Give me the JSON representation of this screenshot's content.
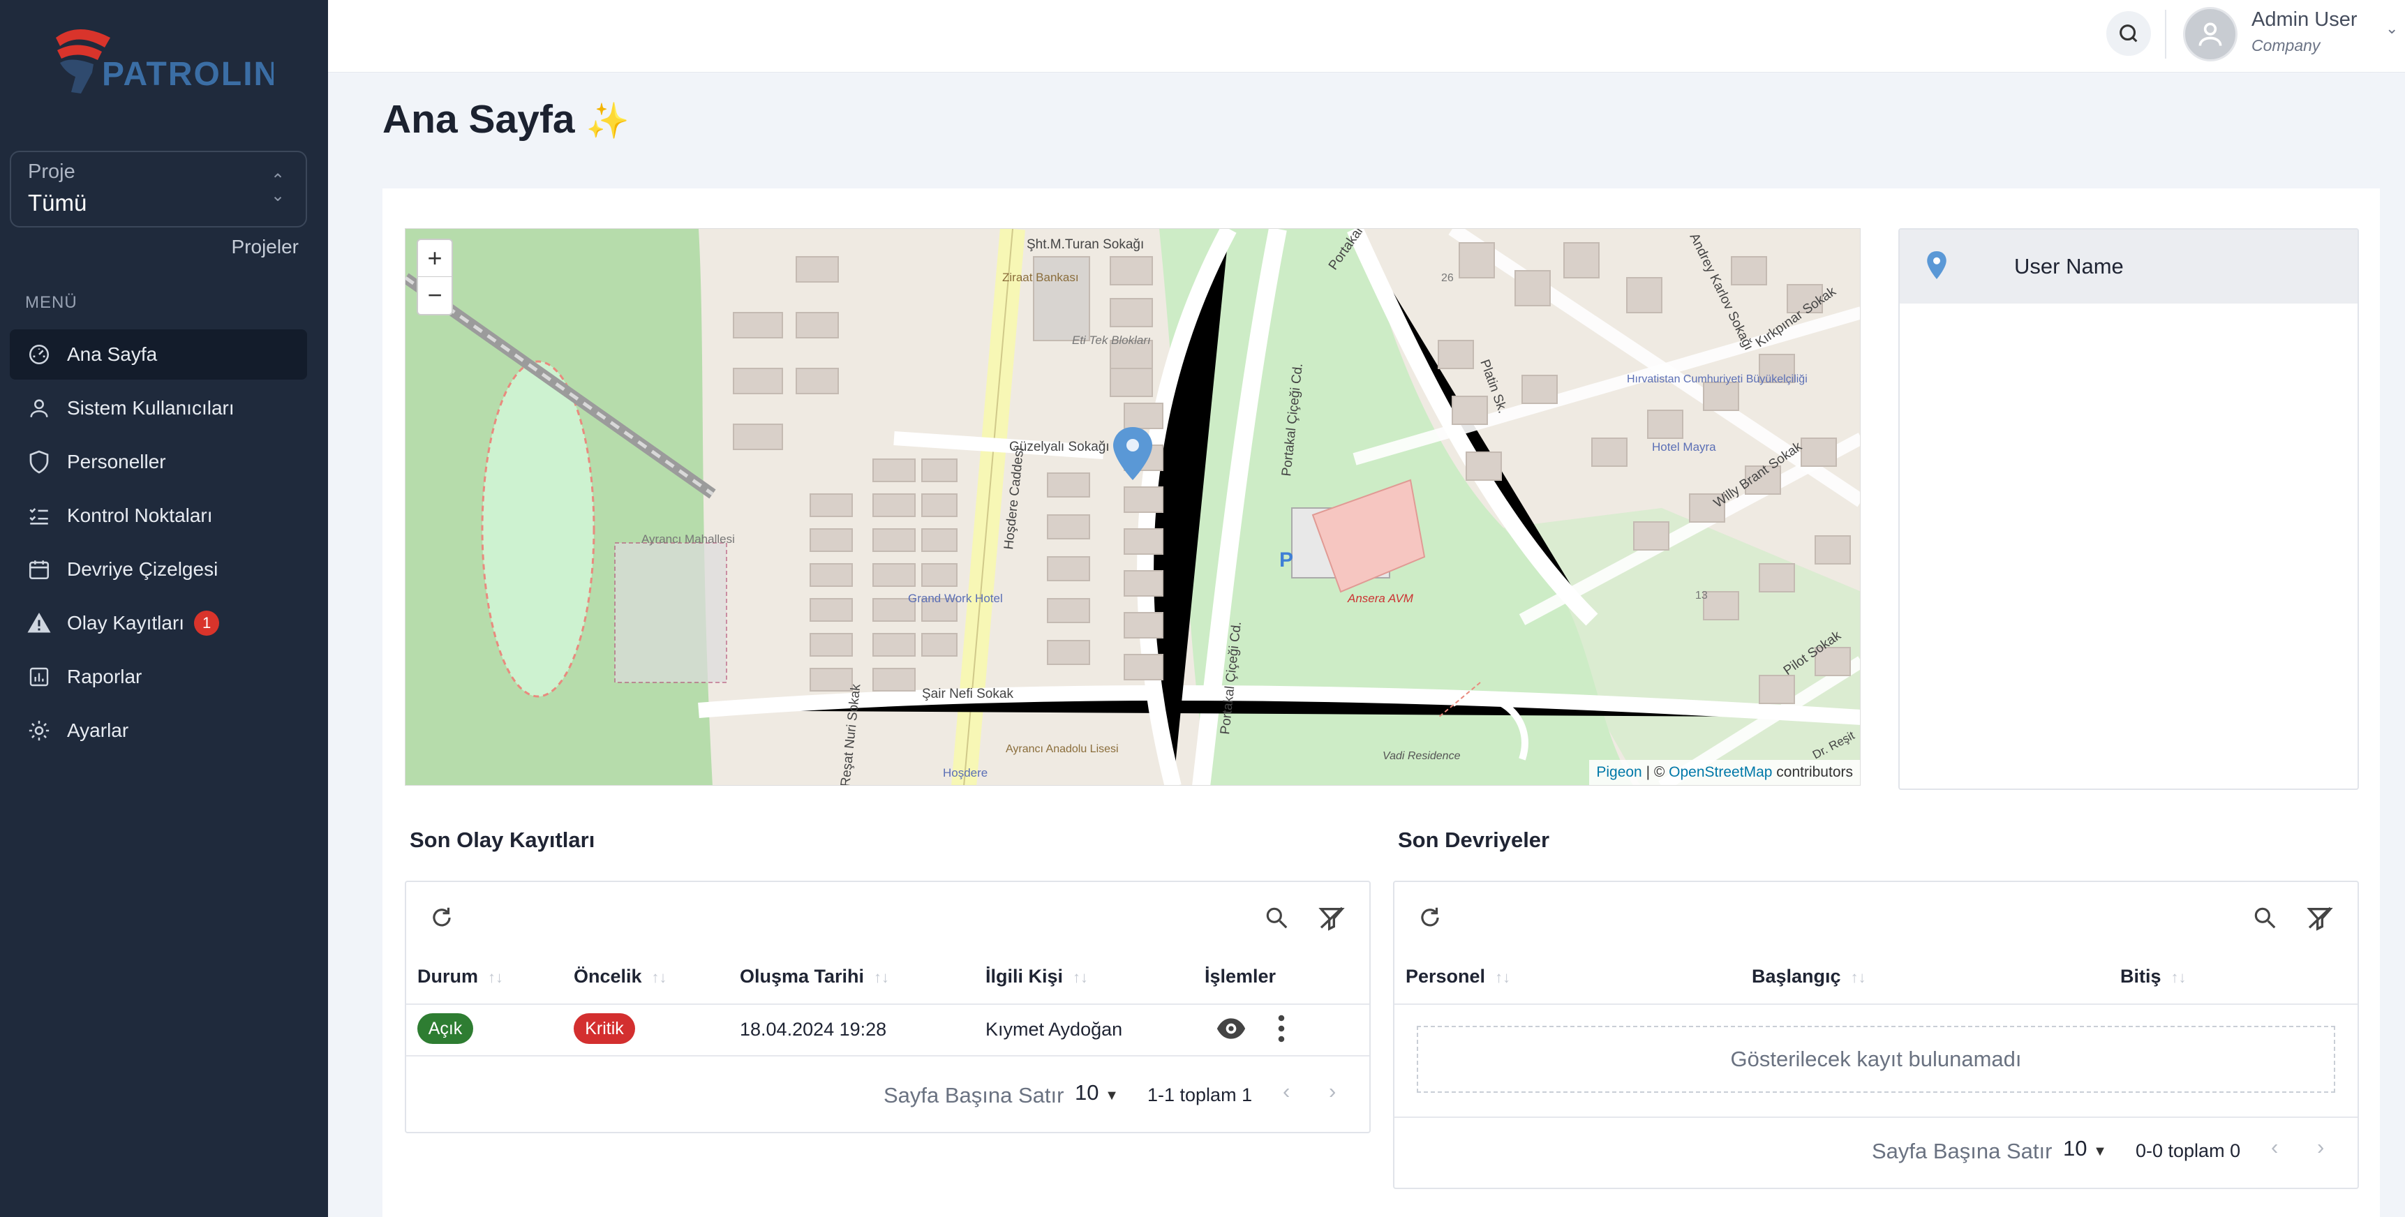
{
  "brand": {
    "name": "PATROLINE"
  },
  "sidebar": {
    "project_label": "Proje",
    "project_value": "Tümü",
    "projects_link": "Projeler",
    "menu_heading": "MENÜ",
    "items": [
      {
        "label": "Ana Sayfa",
        "icon": "dashboard-icon",
        "active": true
      },
      {
        "label": "Sistem Kullanıcıları",
        "icon": "user-icon"
      },
      {
        "label": "Personeller",
        "icon": "shield-icon"
      },
      {
        "label": "Kontrol Noktaları",
        "icon": "checklist-icon"
      },
      {
        "label": "Devriye Çizelgesi",
        "icon": "calendar-icon"
      },
      {
        "label": "Olay Kayıtları",
        "icon": "warning-icon",
        "badge": "1"
      },
      {
        "label": "Raporlar",
        "icon": "chart-icon"
      },
      {
        "label": "Ayarlar",
        "icon": "gear-icon"
      }
    ]
  },
  "header": {
    "user_name": "Admin User",
    "company": "Company"
  },
  "page": {
    "title": "Ana Sayfa",
    "title_emoji": "✨"
  },
  "map": {
    "zoom_in": "+",
    "zoom_out": "−",
    "attribution_link1": "Pigeon",
    "attribution_sep": " | © ",
    "attribution_link2": "OpenStreetMap",
    "attribution_tail": " contributors",
    "labels": {
      "street1": "Şht.M.Turan Sokağı",
      "bank": "Ziraat Bankası",
      "blocks": "Eti Tek Blokları",
      "guzel": "Güzelyalı Sokağı",
      "hosdere_cad": "Hoşdere Caddesi",
      "portakal1": "Portakal Çiçeği Cd.",
      "portakal2": "Portakal Çiçeği Cd.",
      "platin": "Platin Sk.",
      "embassy": "Hırvatistan Cumhuriyeti Büyükelçiliği",
      "hotel_mayra": "Hotel Mayra",
      "andrey": "Andrey Karlov Sokağı",
      "kirkpinar": "Kırkpınar Sokak",
      "willy": "Willy Brant Sokak",
      "pilot": "Pilot Sokak",
      "dr_resit": "Dr. Reşit",
      "ayranci_mah": "Ayrancı Mahallesi",
      "grand": "Grand Work Hotel",
      "ansera": "Ansera AVM",
      "sair_nefi": "Şair Nefi Sokak",
      "resat": "Reşat Nuri Sokak",
      "hosdere": "Hoşdere",
      "lise": "Ayrancı Anadolu Lisesi",
      "vadi": "Vadi Residence",
      "num26": "26",
      "num13": "13",
      "portakal_top": "Portakal",
      "parking": "P"
    }
  },
  "users_list": [
    {
      "name": "User Name"
    }
  ],
  "incidents": {
    "title": "Son Olay Kayıtları",
    "columns": [
      "Durum",
      "Öncelik",
      "Oluşma Tarihi",
      "İlgili Kişi",
      "İşlemler"
    ],
    "rows": [
      {
        "status": "Açık",
        "priority": "Kritik",
        "date": "18.04.2024 19:28",
        "person": "Kıymet Aydoğan"
      }
    ],
    "rows_per_page_label": "Sayfa Başına Satır",
    "rows_per_page": "10",
    "range": "1-1 toplam 1"
  },
  "patrols": {
    "title": "Son Devriyeler",
    "columns": [
      "Personel",
      "Başlangıç",
      "Bitiş"
    ],
    "empty": "Gösterilecek kayıt bulunamadı",
    "rows_per_page_label": "Sayfa Başına Satır",
    "rows_per_page": "10",
    "range": "0-0 toplam 0"
  },
  "colors": {
    "sidebar": "#1f2a3c",
    "status_open": "#2e7d32",
    "priority_critical": "#d32f2f",
    "badge": "#d9342b"
  }
}
